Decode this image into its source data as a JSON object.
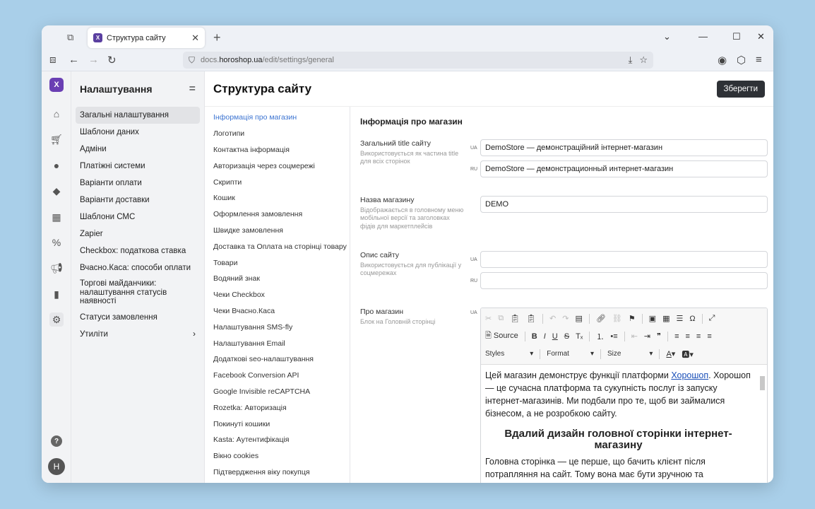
{
  "browser": {
    "tab_title": "Структура сайту",
    "url_prefix": "docs.",
    "url_host": "horoshop.ua",
    "url_path": "/edit/settings/general"
  },
  "sidebar": {
    "title": "Налаштування",
    "items": [
      {
        "label": "Загальні налаштування"
      },
      {
        "label": "Шаблони даних"
      },
      {
        "label": "Адміни"
      },
      {
        "label": "Платіжні системи"
      },
      {
        "label": "Варіанти оплати"
      },
      {
        "label": "Варіанти доставки"
      },
      {
        "label": "Шаблони СМС"
      },
      {
        "label": "Zapier"
      },
      {
        "label": "Checkbox: податкова ставка"
      },
      {
        "label": "Вчасно.Каса: способи оплати"
      },
      {
        "label": "Торгові майданчики: налаштування статусів наявності"
      },
      {
        "label": "Статуси замовлення"
      },
      {
        "label": "Утиліти"
      }
    ]
  },
  "rail": {
    "avatar_letter": "H",
    "help": "?"
  },
  "page": {
    "title": "Структура сайту",
    "save_label": "Зберегти"
  },
  "subnav": [
    "Інформація про магазин",
    "Логотипи",
    "Контактна інформація",
    "Авторизація через соцмережі",
    "Скрипти",
    "Кошик",
    "Оформлення замовлення",
    "Швидке замовлення",
    "Доставка та Оплата на сторінці товару",
    "Товари",
    "Водяний знак",
    "Чеки Checkbox",
    "Чеки Вчасно.Каса",
    "Налаштування SMS-fly",
    "Налаштування Email",
    "Додаткові seo-налаштування",
    "Facebook Conversion API",
    "Google Invisible reCAPTCHA",
    "Rozetka: Авторизація",
    "Покинуті кошики",
    "Kasta: Аутентифікація",
    "Вікно cookies",
    "Підтвердження віку покупця"
  ],
  "form": {
    "section_title": "Інформація про магазин",
    "title_field": {
      "label": "Загальний title сайту",
      "desc": "Використовується як частина title для всіх сторінок",
      "ua_value": "DemoStore — демонстраційний інтернет-магазин",
      "ru_value": "DemoStore — демонстрационный интернет-магазин"
    },
    "name_field": {
      "label": "Назва магазину",
      "desc": "Відображається в головному меню мобільної версії та заголовках фідів для маркетплейсів",
      "value": "DEMO"
    },
    "desc_field": {
      "label": "Опис сайту",
      "desc": "Використовується для публікації у соцмережах",
      "ua_value": "",
      "ru_value": ""
    },
    "about_field": {
      "label": "Про магазин",
      "desc": "Блок на Головній сторінці"
    },
    "lang_ua": "UA",
    "lang_ru": "RU"
  },
  "editor": {
    "source_label": "Source",
    "styles_label": "Styles",
    "format_label": "Format",
    "size_label": "Size",
    "p1_before": "Цей магазин демонструє функції платформи ",
    "p1_link": "Хорошоп",
    "p1_after": ". Хорошоп — це сучасна платформа та сукупність послуг із запуску інтернет-магазинів. Ми подбали про те, щоб ви займалися бізнесом, а не розробкою сайту.",
    "heading": "Вдалий дизайн головної сторінки інтернет-магазину",
    "p2": "Головна сторінка — це перше, що бачить клієнт після потрапляння на сайт. Тому вона має бути зручною та інформативною."
  }
}
